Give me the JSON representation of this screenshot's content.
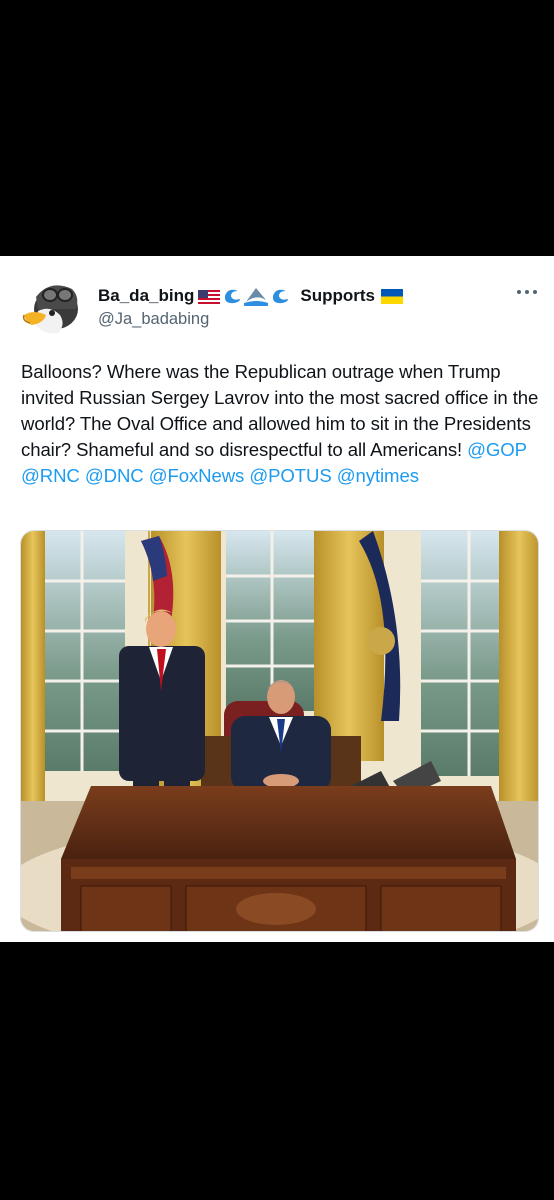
{
  "tweet": {
    "display_name": "Ba_da_bing",
    "supports_label": "Supports",
    "handle": "@Ja_badabing",
    "more_icon": "more-dots-icon",
    "name_icons": [
      "us-flag-icon",
      "wave-icon",
      "shark-icon",
      "wave-icon",
      "ukraine-flag-icon"
    ],
    "text": "Balloons? Where was the Republican outrage when Trump invited Russian Sergey Lavrov into the most sacred office in the world? The Oval Office and allowed him to sit in the Presidents chair? Shameful and so disrespectful to all Americans!",
    "mentions": [
      "@GOP",
      "@RNC",
      "@DNC",
      "@FoxNews",
      "@POTUS",
      "@nytimes"
    ]
  },
  "colors": {
    "background": "#000000",
    "card": "#ffffff",
    "text": "#0f1419",
    "secondary_text": "#536471",
    "link": "#1d9bf0"
  }
}
